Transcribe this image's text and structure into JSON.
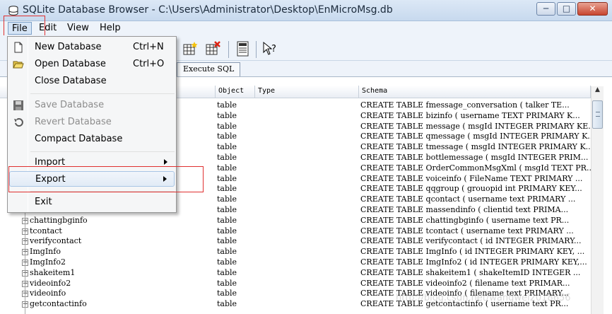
{
  "window": {
    "title": "SQLite Database Browser - C:\\Users\\Administrator\\Desktop\\EnMicroMsg.db",
    "minimize_glyph": "─",
    "maximize_glyph": "□",
    "close_glyph": "✕"
  },
  "menubar": [
    {
      "label": "File"
    },
    {
      "label": "Edit"
    },
    {
      "label": "View"
    },
    {
      "label": "Help"
    }
  ],
  "tabs": {
    "execute_sql": "Execute SQL"
  },
  "file_menu": {
    "new_database": {
      "label": "New Database",
      "shortcut": "Ctrl+N"
    },
    "open_database": {
      "label": "Open Database",
      "shortcut": "Ctrl+O"
    },
    "close_database": {
      "label": "Close Database"
    },
    "save_database": {
      "label": "Save Database"
    },
    "revert_database": {
      "label": "Revert Database"
    },
    "compact_database": {
      "label": "Compact Database"
    },
    "import": {
      "label": "Import"
    },
    "export": {
      "label": "Export"
    },
    "exit": {
      "label": "Exit"
    }
  },
  "table": {
    "columns": {
      "object": "Object",
      "type": "Type",
      "schema": "Schema"
    },
    "rows": [
      {
        "name": "",
        "object": "table",
        "schema": "CREATE TABLE fmessage_conversation (  talker TE..."
      },
      {
        "name": "",
        "object": "table",
        "schema": "CREATE TABLE bizinfo (  username TEXT PRIMARY K..."
      },
      {
        "name": "",
        "object": "table",
        "schema": "CREATE TABLE message ( msgId INTEGER PRIMARY KE..."
      },
      {
        "name": "",
        "object": "table",
        "schema": "CREATE TABLE qmessage ( msgId INTEGER PRIMARY K..."
      },
      {
        "name": "",
        "object": "table",
        "schema": "CREATE TABLE tmessage ( msgId INTEGER PRIMARY K..."
      },
      {
        "name": "",
        "object": "table",
        "schema": "CREATE TABLE bottlemessage ( msgId INTEGER PRIM..."
      },
      {
        "name": "",
        "object": "table",
        "schema": "CREATE TABLE OrderCommonMsgXml (  msgId TEXT PR..."
      },
      {
        "name": "",
        "object": "table",
        "schema": "CREATE TABLE voiceinfo ( FileName TEXT PRIMARY ..."
      },
      {
        "name": "",
        "object": "table",
        "schema": "CREATE TABLE qqgroup ( grouopid int PRIMARY KEY..."
      },
      {
        "name": "",
        "object": "table",
        "schema": "CREATE TABLE qcontact ( username text  PRIMARY ..."
      },
      {
        "name": "",
        "object": "table",
        "schema": "CREATE TABLE massendinfo ( clientid text  PRIMA..."
      },
      {
        "name": "chattingbginfo",
        "object": "table",
        "schema": "CREATE TABLE chattingbginfo ( username text  PR..."
      },
      {
        "name": "tcontact",
        "object": "table",
        "schema": "CREATE TABLE tcontact ( username text  PRIMARY ..."
      },
      {
        "name": "verifycontact",
        "object": "table",
        "schema": "CREATE TABLE verifycontact ( id INTEGER PRIMARY..."
      },
      {
        "name": "ImgInfo",
        "object": "table",
        "schema": "CREATE TABLE ImgInfo ( id INTEGER PRIMARY KEY, ..."
      },
      {
        "name": "ImgInfo2",
        "object": "table",
        "schema": "CREATE TABLE ImgInfo2 ( id INTEGER PRIMARY KEY,..."
      },
      {
        "name": "shakeitem1",
        "object": "table",
        "schema": "CREATE TABLE shakeitem1 (  shakeItemID INTEGER ..."
      },
      {
        "name": "videoinfo2",
        "object": "table",
        "schema": "CREATE TABLE videoinfo2 ( filename text  PRIMAR..."
      },
      {
        "name": "videoinfo",
        "object": "table",
        "schema": "CREATE TABLE videoinfo ( filename text  PRIMARY..."
      },
      {
        "name": "getcontactinfo",
        "object": "table",
        "schema": "CREATE TABLE getcontactinfo ( username text  PR..."
      }
    ]
  },
  "colors": {
    "annotation_red": "#e03030",
    "menu_highlight": "#a8c5e5"
  },
  "watermark": "http://blog.csdn.net/wangwei2018656"
}
